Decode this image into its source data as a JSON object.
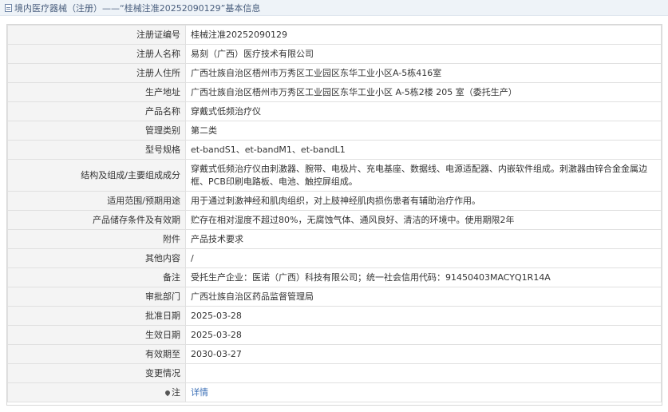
{
  "header": {
    "title": "境内医疗器械（注册）——“桂械注准20252090129”基本信息"
  },
  "rows": [
    {
      "label": "注册证编号",
      "value": "桂械注准20252090129"
    },
    {
      "label": "注册人名称",
      "value": "易刻（广西）医疗技术有限公司"
    },
    {
      "label": "注册人住所",
      "value": "广西壮族自治区梧州市万秀区工业园区东华工业小区A-5栋416室"
    },
    {
      "label": "生产地址",
      "value": "广西壮族自治区梧州市万秀区工业园区东华工业小区 A-5栋2楼 205 室（委托生产）"
    },
    {
      "label": "产品名称",
      "value": "穿戴式低频治疗仪"
    },
    {
      "label": "管理类别",
      "value": "第二类"
    },
    {
      "label": "型号规格",
      "value": "et-bandS1、et-bandM1、et-bandL1"
    },
    {
      "label": "结构及组成/主要组成成分",
      "value": "穿戴式低频治疗仪由刺激器、腕带、电极片、充电基座、数据线、电源适配器、内嵌软件组成。刺激器由锌合金金属边框、PCB印刷电路板、电池、触控屏组成。"
    },
    {
      "label": "适用范围/预期用途",
      "value": "用于通过刺激神经和肌肉组织，对上肢神经肌肉损伤患者有辅助治疗作用。"
    },
    {
      "label": "产品储存条件及有效期",
      "value": "贮存在相对湿度不超过80%，无腐蚀气体、通风良好、清洁的环境中。使用期限2年"
    },
    {
      "label": "附件",
      "value": "产品技术要求"
    },
    {
      "label": "其他内容",
      "value": "/"
    },
    {
      "label": "备注",
      "value": "受托生产企业：医诺（广西）科技有限公司；统一社会信用代码：91450403MACYQ1R14A"
    },
    {
      "label": "审批部门",
      "value": "广西壮族自治区药品监督管理局"
    },
    {
      "label": "批准日期",
      "value": "2025-03-28"
    },
    {
      "label": "生效日期",
      "value": "2025-03-28"
    },
    {
      "label": "有效期至",
      "value": "2030-03-27"
    },
    {
      "label": "变更情况",
      "value": ""
    }
  ],
  "note_row": {
    "label": "注",
    "link": "详情",
    "icon": "pin-icon"
  }
}
